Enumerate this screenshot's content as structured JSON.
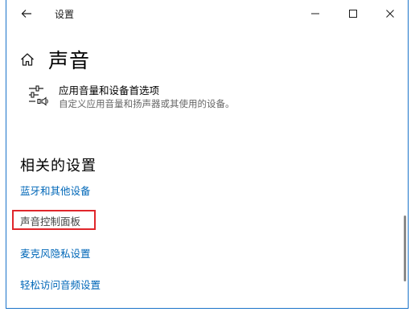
{
  "window": {
    "title": "设置",
    "accent_color": "#1a73c9"
  },
  "header": {
    "page_title": "声音"
  },
  "option": {
    "title": "应用音量和设备首选项",
    "description": "自定义应用音量和扬声器或其使用的设备。",
    "icon": "mixer-sliders-speaker-icon"
  },
  "related": {
    "section_title": "相关的设置",
    "links": [
      {
        "label": "蓝牙和其他设备"
      },
      {
        "label": "声音控制面板",
        "highlighted": true
      },
      {
        "label": "麦克风隐私设置"
      },
      {
        "label": "轻松访问音频设置"
      }
    ],
    "link_color": "#0067b8",
    "highlight_color": "#e0262b"
  }
}
